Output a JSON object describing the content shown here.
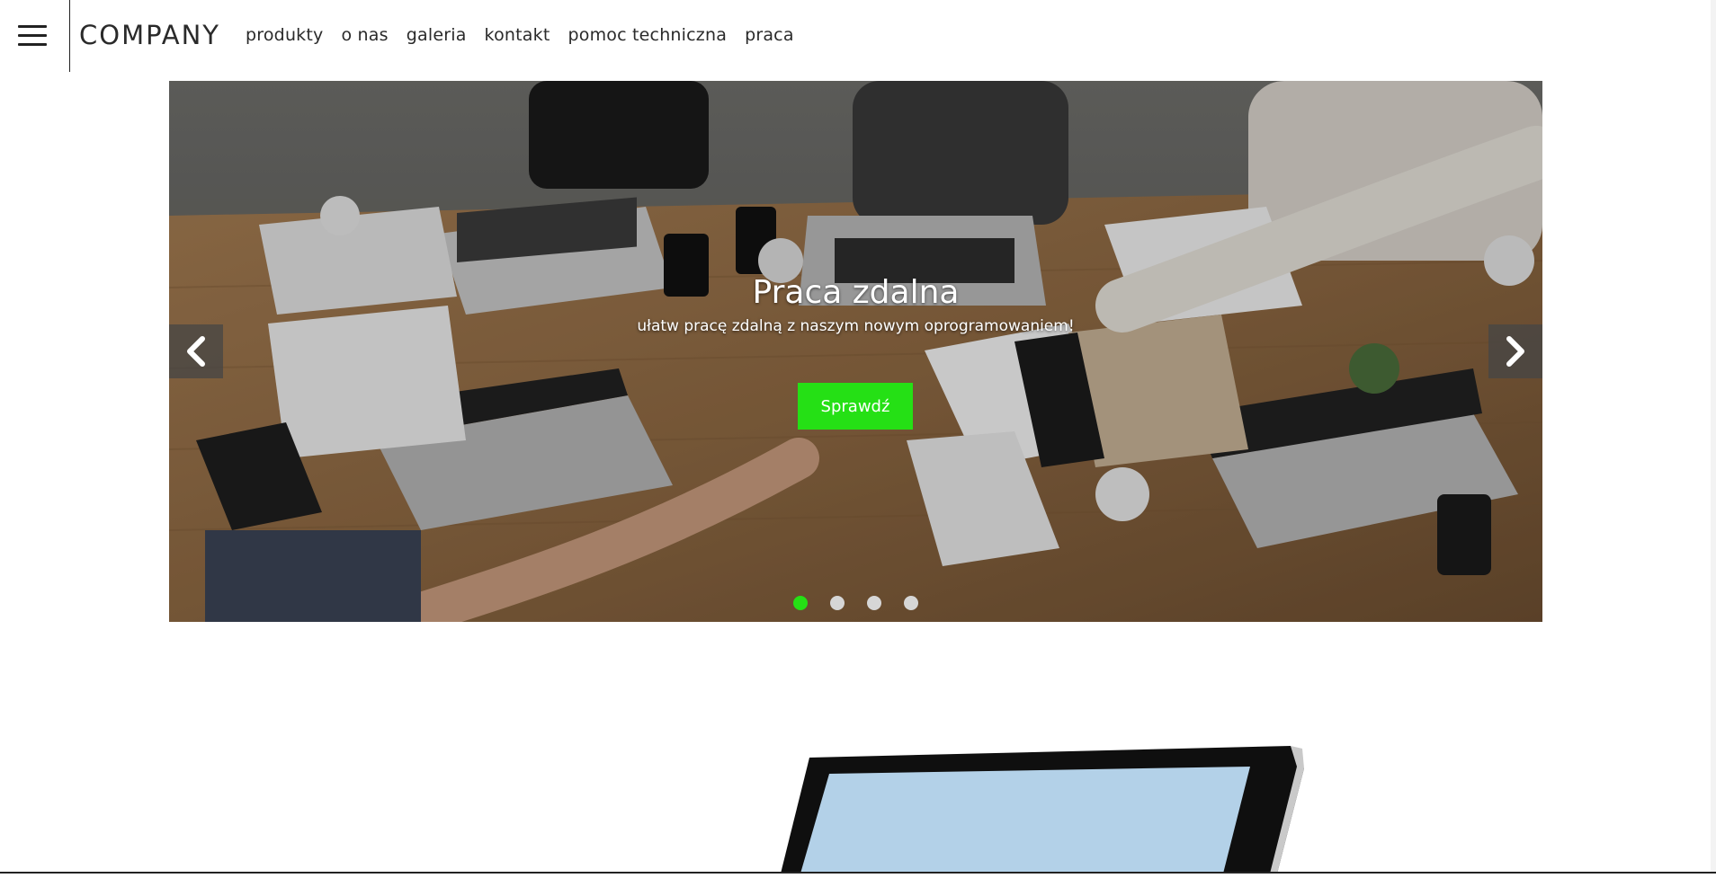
{
  "header": {
    "logo": "COMPANY",
    "nav": [
      "produkty",
      "o nas",
      "galeria",
      "kontakt",
      "pomoc techniczna",
      "praca"
    ]
  },
  "carousel": {
    "title": "Praca zdalna",
    "subtitle": "ułatw pracę zdalną z naszym nowym oprogramowaniem!",
    "button_label": "Sprawdź",
    "slide_count": 4,
    "active_slide": 1,
    "prev_icon": "chevron-left-icon",
    "next_icon": "chevron-right-icon"
  },
  "colors": {
    "accent": "#25e015",
    "text": "#2a2a2a",
    "background": "#ffffff"
  }
}
